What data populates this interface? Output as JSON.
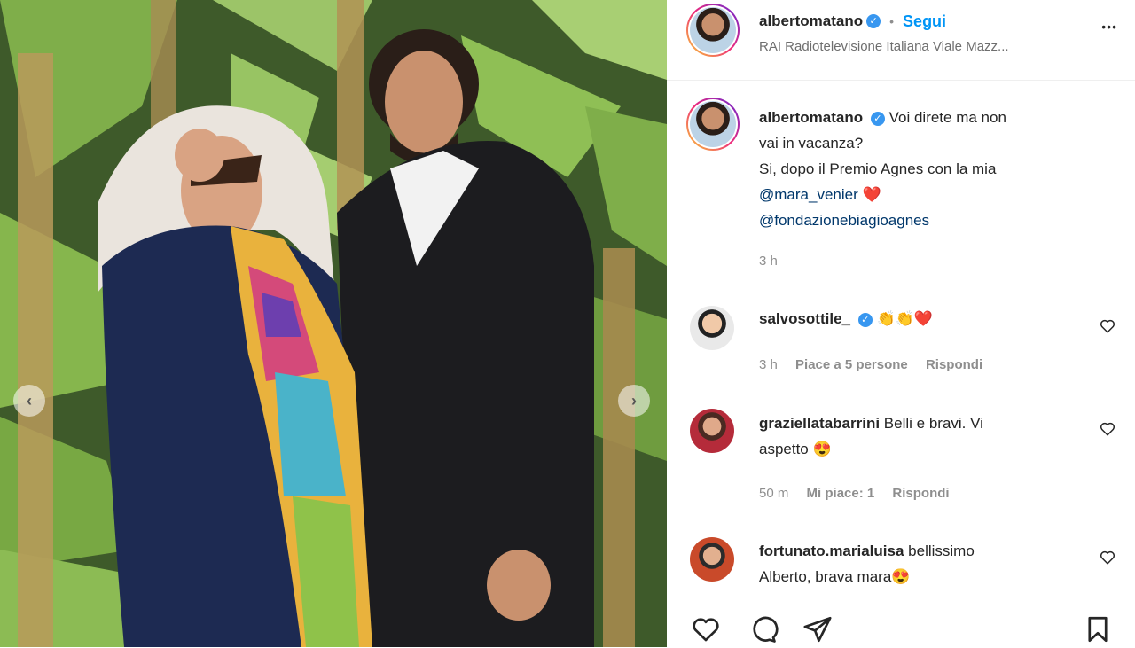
{
  "post": {
    "author": "albertomatano",
    "follow_label": "Segui",
    "separator": "•",
    "location": "RAI Radiotelevisione Italiana Viale Mazz...",
    "more_label": "•••"
  },
  "caption": {
    "author": "albertomatano",
    "line1": "Voi direte ma non",
    "line2": "vai in vacanza?",
    "line3": "Si, dopo il Premio Agnes con la mia",
    "mention1": "@mara_venier",
    "mention1_emoji": "❤️",
    "mention2": "@fondazionebiagioagnes",
    "time": "3 h"
  },
  "comments": [
    {
      "author": "salvosottile_",
      "text": "👏👏❤️",
      "time": "3 h",
      "likes": "Piace a 5 persone",
      "reply": "Rispondi"
    },
    {
      "author": "graziellatabarrini",
      "text": "Belli e bravi. Vi",
      "text2": "aspetto 😍",
      "time": "50 m",
      "likes": "Mi piace: 1",
      "reply": "Rispondi"
    },
    {
      "author": "fortunato.marialuisa",
      "text": "bellissimo",
      "text2": "Alberto, brava mara😍"
    }
  ],
  "colors": {
    "accent": "#0095f6",
    "verified": "#3897f0",
    "heart": "#ed4956"
  },
  "icons": [
    "heart-icon",
    "comment-icon",
    "share-icon",
    "bookmark-icon",
    "chevron-left-icon",
    "chevron-right-icon"
  ]
}
